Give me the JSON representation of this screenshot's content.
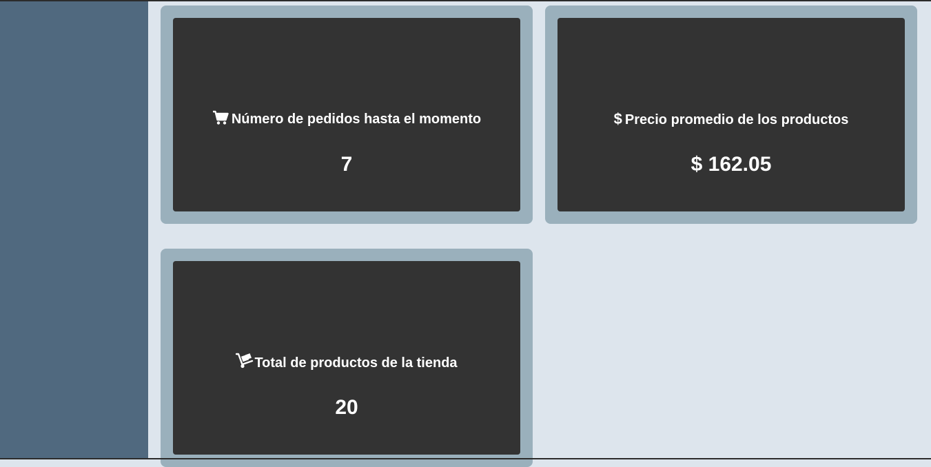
{
  "cards": [
    {
      "icon": "shopping-cart-icon",
      "title": "Número de pedidos hasta el momento",
      "value": "7"
    },
    {
      "icon": "dollar-icon",
      "icon_glyph": "$",
      "title": "Precio promedio de los productos",
      "value": "$ 162.05"
    },
    {
      "icon": "dolly-icon",
      "title": "Total de productos de la tienda",
      "value": "20"
    }
  ],
  "colors": {
    "sidebar": "#50697f",
    "background": "#dde5ed",
    "card_frame": "#9ab0bc",
    "card": "#333333",
    "text": "#ffffff"
  }
}
